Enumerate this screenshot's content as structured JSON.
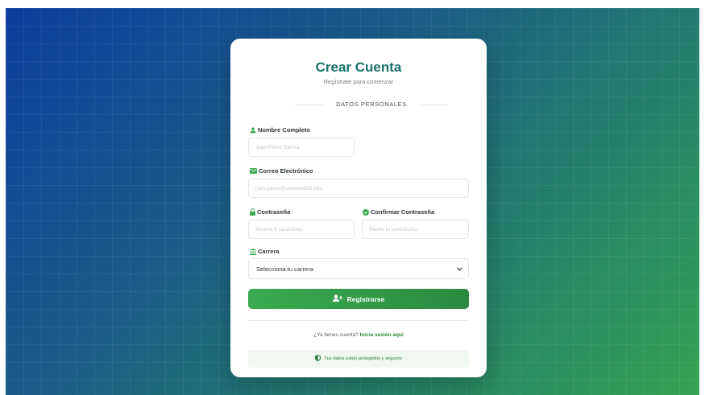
{
  "header": {
    "title": "Crear Cuenta",
    "subtitle": "Regístrate para comenzar"
  },
  "section": {
    "label": "DATOS PERSONALES"
  },
  "fields": {
    "name": {
      "label": "Nombre Completo",
      "value": "",
      "placeholder": "Juan Pérez García"
    },
    "email": {
      "label": "Correo Electrónico",
      "value": "",
      "placeholder": "juan.perez@universidad.edu"
    },
    "password": {
      "label": "Contraseña",
      "value": "",
      "placeholder": "Mínimo 6 caracteres"
    },
    "confirm": {
      "label": "Confirmar Contraseña",
      "value": "",
      "placeholder": "Repite tu contraseña"
    },
    "career": {
      "label": "Carrera",
      "selected": "Selecciona tu carrera"
    }
  },
  "submit": {
    "label": "Registrarse"
  },
  "login": {
    "prompt": "¿Ya tienes cuenta?",
    "link": "Inicia sesión aquí"
  },
  "secure": {
    "text": "Tus datos están protegidos y seguros"
  },
  "icons": {
    "name": "user-icon",
    "email": "envelope-icon",
    "password": "lock-icon",
    "confirm": "check-circle-icon",
    "career": "university-icon",
    "submit": "user-plus-icon",
    "secure": "shield-icon",
    "select": "chevron-down-icon"
  },
  "colors": {
    "title": "#17706a",
    "accent": "#3cab50",
    "link": "#2a8a3f"
  }
}
